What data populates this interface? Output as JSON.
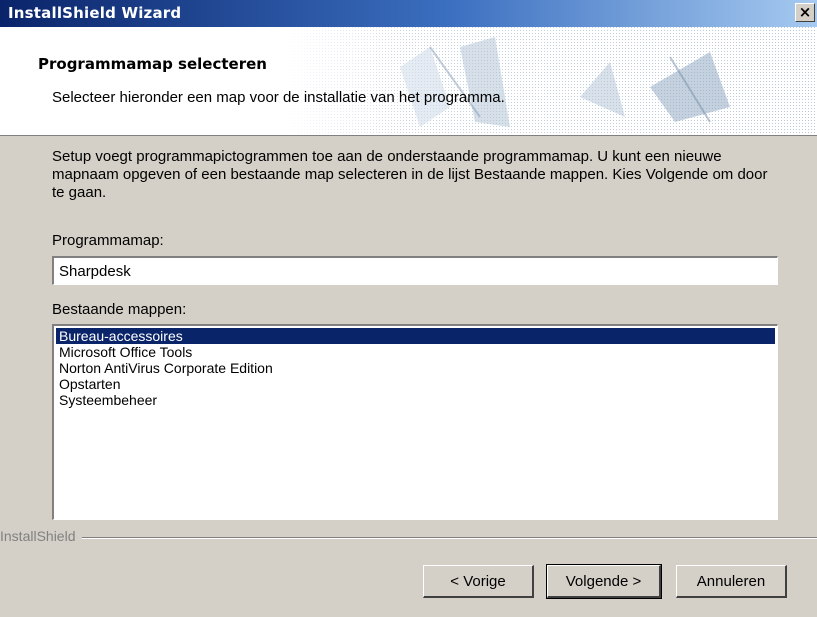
{
  "window": {
    "title": "InstallShield Wizard",
    "close_symbol": "×",
    "title_bar_color": "#0a246a"
  },
  "header": {
    "title": "Programmamap selecteren",
    "subtitle": "Selecteer hieronder een map voor de installatie van het programma."
  },
  "body": {
    "description": "Setup voegt programmapictogrammen toe aan de onderstaande programmamap. U kunt een nieuwe mapnaam opgeven of een bestaande map selecteren in de lijst Bestaande mappen. Kies Volgende om door te gaan.",
    "folder_label": "Programmamap:",
    "folder_value": "Sharpdesk",
    "existing_label": "Bestaande mappen:",
    "existing_folders": [
      "Bureau-accessoires",
      "Microsoft Office Tools",
      "Norton AntiVirus Corporate Edition",
      "Opstarten",
      "Systeembeheer"
    ],
    "selected_index": 0,
    "selection_color": "#0a246a"
  },
  "footer": {
    "brand": "InstallShield",
    "back_label": "< Vorige",
    "next_label": "Volgende >",
    "cancel_label": "Annuleren"
  }
}
